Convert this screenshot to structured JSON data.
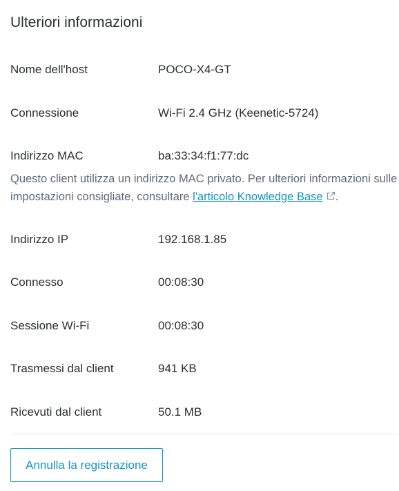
{
  "panel": {
    "title": "Ulteriori informazioni"
  },
  "rows": {
    "hostname": {
      "label": "Nome dell'host",
      "value": "POCO-X4-GT"
    },
    "connection": {
      "label": "Connessione",
      "value": "Wi-Fi 2.4 GHz (Keenetic-5724)"
    },
    "mac": {
      "label": "Indirizzo MAC",
      "value": "ba:33:34:f1:77:dc"
    },
    "ip": {
      "label": "Indirizzo IP",
      "value": "192.168.1.85"
    },
    "connected": {
      "label": "Connesso",
      "value": "00:08:30"
    },
    "wifi_session": {
      "label": "Sessione Wi-Fi",
      "value": "00:08:30"
    },
    "sent": {
      "label": "Trasmessi dal client",
      "value": "941 KB"
    },
    "received": {
      "label": "Ricevuti dal client",
      "value": "50.1 MB"
    }
  },
  "mac_note": {
    "text_before": "Questo client utilizza un indirizzo MAC privato. Per ulteriori informazioni sulle impostazioni consigliate, consultare ",
    "link_text": "l'articolo Knowledge Base",
    "text_after": "."
  },
  "actions": {
    "unregister_label": "Annulla la registrazione"
  },
  "icons": {
    "link_icon": "external-link-icon"
  },
  "colors": {
    "accent": "#1594c4",
    "text": "#2b2f33",
    "muted_text": "#5d6b79",
    "divider": "#e3e6e9"
  }
}
